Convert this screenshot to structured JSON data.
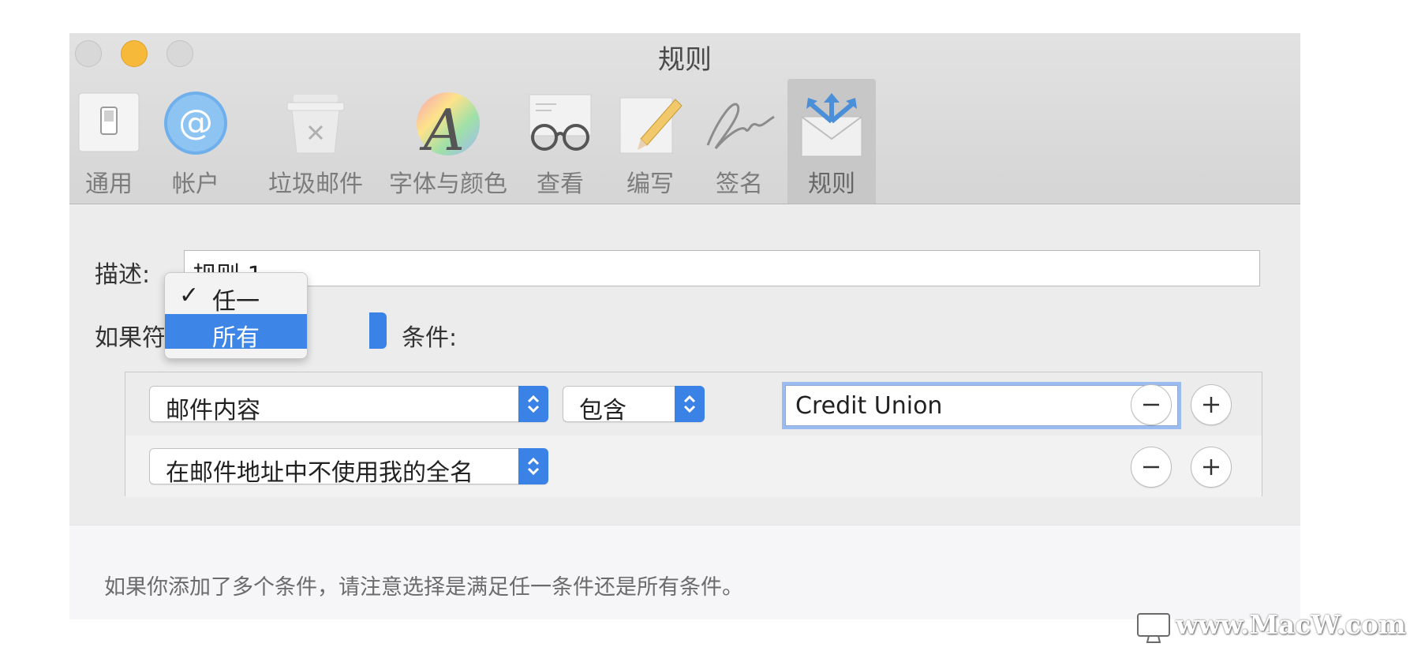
{
  "window": {
    "title": "规则"
  },
  "toolbar": {
    "items": [
      {
        "label": "通用",
        "icon": "switch-icon"
      },
      {
        "label": "帐户",
        "icon": "at-icon"
      },
      {
        "label": "垃圾邮件",
        "icon": "trash-bin-icon"
      },
      {
        "label": "字体与颜色",
        "icon": "font-color-icon"
      },
      {
        "label": "查看",
        "icon": "glasses-icon"
      },
      {
        "label": "编写",
        "icon": "pencil-icon"
      },
      {
        "label": "签名",
        "icon": "signature-icon"
      },
      {
        "label": "规则",
        "icon": "rules-envelope-icon",
        "active": true
      }
    ]
  },
  "form": {
    "description_label": "描述:",
    "description_value": "规则 1",
    "condition_prefix": "如果符合下列",
    "condition_suffix": "条件:",
    "match_menu": {
      "options": [
        "任一",
        "所有"
      ],
      "checked": "任一",
      "highlighted": "所有"
    }
  },
  "rules": [
    {
      "field": "邮件内容",
      "operator": "包含",
      "value": "Credit Union"
    },
    {
      "field": "在邮件地址中不使用我的全名"
    }
  ],
  "footer": {
    "note": "如果你添加了多个条件，请注意选择是满足任一条件还是所有条件。"
  },
  "watermark": {
    "text": "www.MacW.com"
  },
  "colors": {
    "accent": "#3b82e6",
    "min_button": "#f6b93a"
  }
}
